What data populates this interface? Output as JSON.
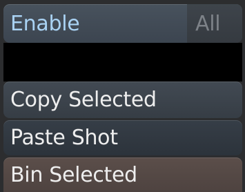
{
  "enable_row": {
    "label": "Enable",
    "value": "All"
  },
  "actions": {
    "copy_selected": "Copy Selected",
    "paste_shot": "Paste Shot",
    "bin_selected": "Bin Selected"
  },
  "colors": {
    "enable_label": "#a9d2f3",
    "all_value": "#7d8288",
    "action_text": "#eeeeee",
    "button_bg": "#3c4550",
    "bin_bg": "#554845",
    "separator": "#000000"
  }
}
